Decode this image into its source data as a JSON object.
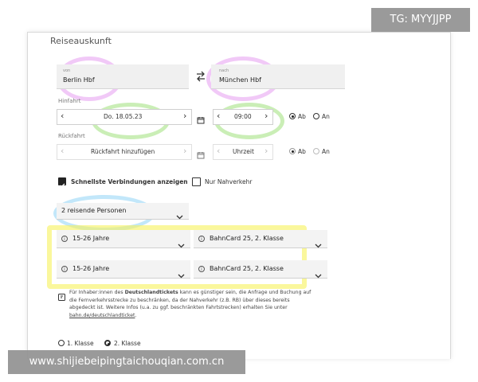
{
  "form": {
    "title": "Reiseauskunft",
    "from": {
      "label": "von",
      "value": "Berlin Hbf"
    },
    "swap_icon": "swap-arrows-icon",
    "to": {
      "label": "nach",
      "value": "München Hbf"
    },
    "outbound": {
      "label": "Hinfahrt",
      "date": "Do. 18.05.23",
      "time": "09:00",
      "ab": "Ab",
      "an": "An",
      "selected": "Ab"
    },
    "return": {
      "label": "Rückfahrt",
      "date_placeholder": "Rückfahrt hinzufügen",
      "time_placeholder": "Uhrzeit",
      "ab": "Ab",
      "an": "An"
    },
    "options": {
      "fastest": {
        "label": "Schnellste Verbindungen anzeigen",
        "checked": true
      },
      "local": {
        "label": "Nur Nahverkehr",
        "checked": false
      }
    },
    "travelers": {
      "value": "2 reisende Personen"
    },
    "passengers": [
      {
        "age": "15-26 Jahre",
        "card": "BahnCard 25, 2. Klasse"
      },
      {
        "age": "15-26 Jahre",
        "card": "BahnCard 25, 2. Klasse"
      }
    ],
    "notice": {
      "intro": "Für Inhaber:innen des",
      "bold": "Deutschlandtickets",
      "rest1": "kann es günstiger sein, die Anfrage und Buchung auf",
      "line2": "die Fernverkehrsstrecke zu beschränken, da der Nahverkehr (z.B. RB) über dieses bereits",
      "line3": "abgedeckt ist. Weitere Infos (u.a. zu ggf. beschränkten Fahrtstrecken) erhalten Sie unter",
      "link": "bahn.de/deutschlandticket"
    },
    "class": {
      "first": "1. Klasse",
      "second": "2. Klasse",
      "selected": "2. Klasse"
    }
  },
  "watermarks": {
    "top": "TG: MYYJJPP",
    "bottom": "www.shijiebeipingtaichouqian.com.cn"
  },
  "colors": {
    "highlight_purple": "#e59cf0",
    "highlight_green": "#9fe07a",
    "highlight_blue": "#8fd3f5",
    "highlight_yellow": "#f7f25a",
    "watermark_bg": "#919191"
  }
}
